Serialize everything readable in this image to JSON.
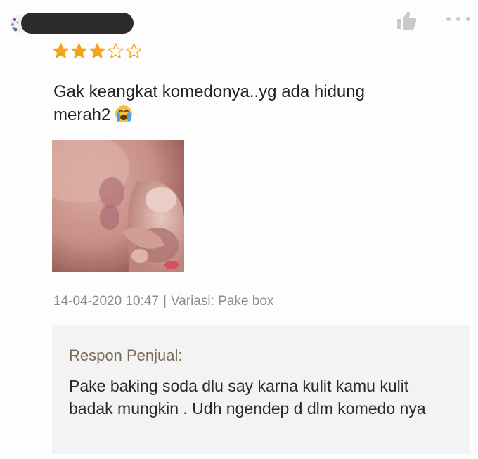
{
  "review": {
    "rating": 3,
    "rating_max": 5,
    "text_line1": "Gak keangkat komedonya..yg ada hidung",
    "text_line2": "merah2",
    "emoji": "crying-face",
    "timestamp": "14-04-2020 10:47",
    "separator": "|",
    "variation": "Variasi: Pake box"
  },
  "seller_response": {
    "label": "Respon Penjual:",
    "text": "Pake baking soda dlu say karna kulit kamu kulit badak mungkin . Udh ngendep d dlm komedo nya"
  },
  "colors": {
    "star_filled": "#f2a516",
    "star_empty": "#f2a516",
    "label_brown": "#7a6a52",
    "meta_gray": "#8a8a8a",
    "response_bg": "#f3f3f3"
  },
  "icons": {
    "like": "thumbs-up-icon",
    "more": "more-dots-icon"
  }
}
